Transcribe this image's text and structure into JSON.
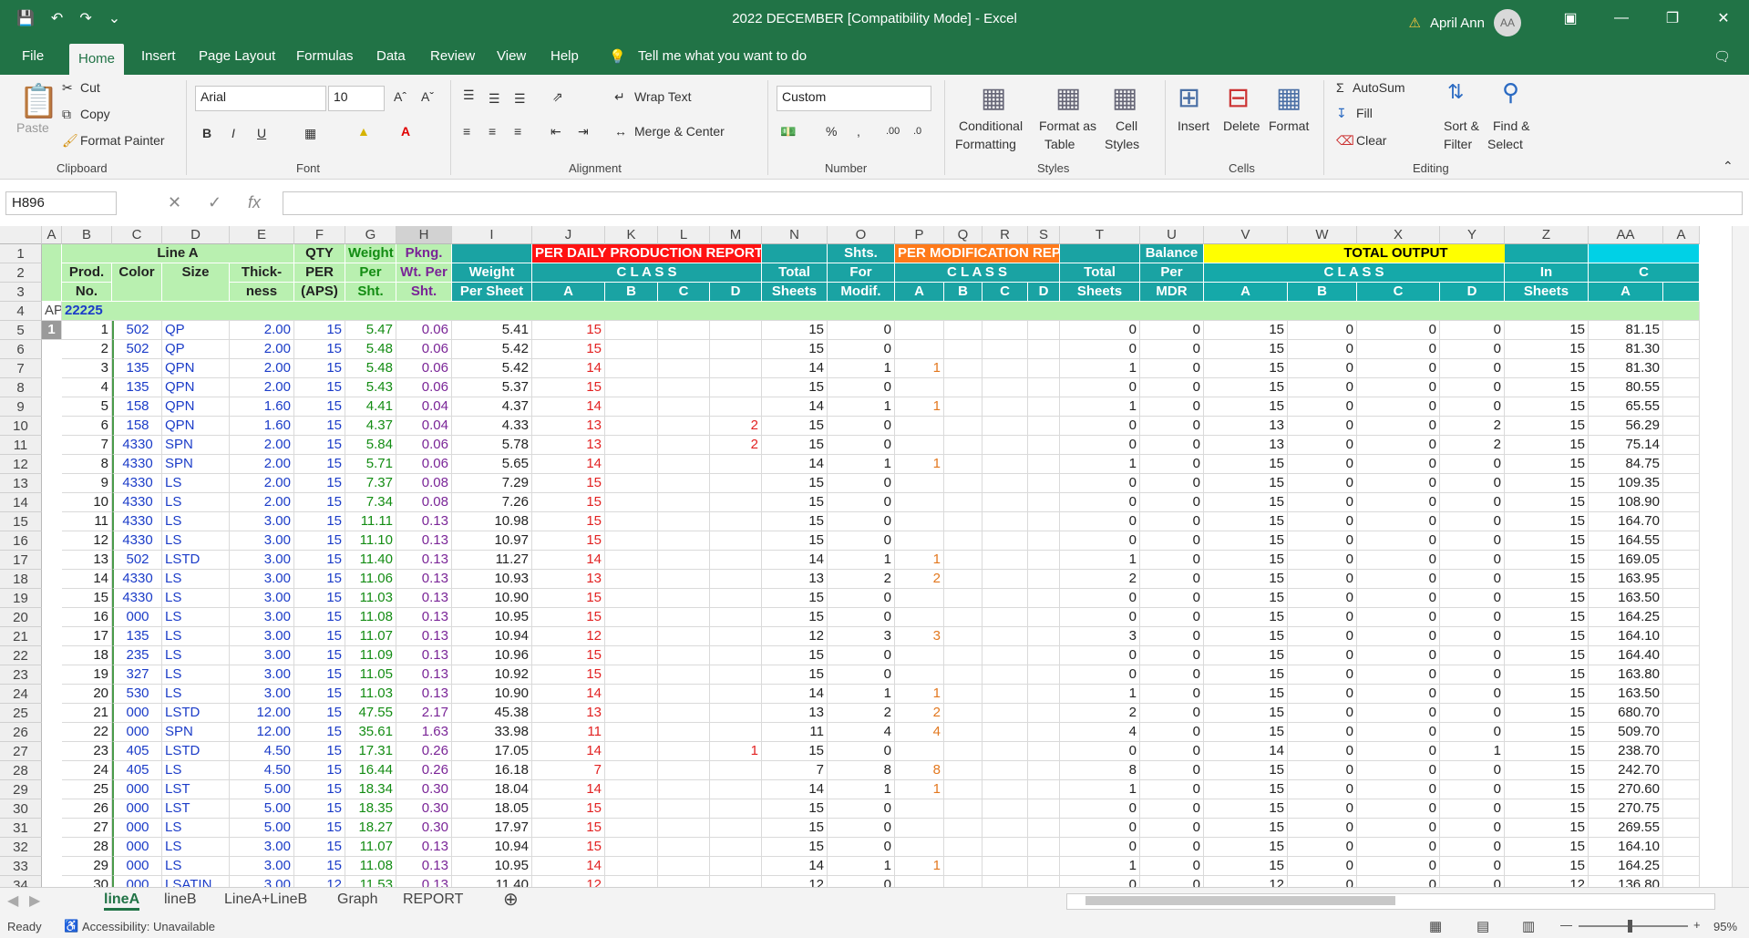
{
  "titlebar": {
    "title": "2022 DECEMBER  [Compatibility Mode]  -  Excel",
    "user_name": "April Ann",
    "avatar_initials": "AA"
  },
  "menu": {
    "tabs": [
      "File",
      "Home",
      "Insert",
      "Page Layout",
      "Formulas",
      "Data",
      "Review",
      "View",
      "Help"
    ],
    "active": "Home",
    "tell_me": "Tell me what you want to do"
  },
  "ribbon": {
    "clipboard": {
      "paste": "Paste",
      "cut": "Cut",
      "copy": "Copy",
      "format_painter": "Format Painter",
      "label": "Clipboard"
    },
    "font": {
      "name": "Arial",
      "size": "10",
      "label": "Font"
    },
    "alignment": {
      "wrap_text": "Wrap Text",
      "merge_center": "Merge & Center",
      "label": "Alignment"
    },
    "number": {
      "format": "Custom",
      "label": "Number"
    },
    "styles": {
      "conditional": "Conditional",
      "formatting": "Formatting",
      "format_as": "Format as",
      "table": "Table",
      "cell": "Cell",
      "cell_styles": "Styles",
      "label": "Styles"
    },
    "cells": {
      "insert": "Insert",
      "delete": "Delete",
      "format": "Format",
      "label": "Cells"
    },
    "editing": {
      "autosum": "AutoSum",
      "fill": "Fill",
      "clear": "Clear",
      "sort": "Sort &",
      "filter": "Filter",
      "find": "Find &",
      "select": "Select",
      "label": "Editing"
    }
  },
  "formula_bar": {
    "name_box": "H896",
    "formula": ""
  },
  "columns": [
    "A",
    "B",
    "C",
    "D",
    "E",
    "F",
    "G",
    "H",
    "I",
    "J",
    "K",
    "L",
    "M",
    "N",
    "O",
    "P",
    "Q",
    "R",
    "S",
    "T",
    "U",
    "V",
    "W",
    "X",
    "Y",
    "Z",
    "AA",
    "A"
  ],
  "row_numbers": [
    "1",
    "2",
    "3",
    "4",
    "5",
    "6",
    "7",
    "8",
    "9",
    "10",
    "11",
    "12",
    "13",
    "14",
    "15",
    "16",
    "17",
    "18",
    "19",
    "20",
    "21",
    "22",
    "23",
    "24",
    "25",
    "26",
    "27",
    "28",
    "29",
    "30",
    "31",
    "32",
    "33",
    "34"
  ],
  "headers": {
    "line_a": "Line A",
    "prod_no_1": "Prod.",
    "prod_no_2": "No.",
    "color": "Color",
    "size": "Size",
    "thick_1": "Thick-",
    "thick_2": "ness",
    "qty_1": "QTY",
    "qty_2": "PER",
    "qty_3": "(APS)",
    "weight_1": "Weight",
    "weight_2": "Per",
    "weight_3": "Sht.",
    "pkng_1": "Pkng.",
    "pkng_2": "Wt. Per",
    "pkng_3": "Sht.",
    "wps_1": "Weight",
    "wps_2": "Per Sheet",
    "dpr": "PER DAILY PRODUCTION REPORT (DPR)",
    "class": "C L A S S",
    "total_1": "Total",
    "total_2": "Sheets",
    "shts_1": "Shts.",
    "shts_2": "For",
    "shts_3": "Modif.",
    "mr": "PER MODIFICATION REPORT (MR)",
    "balance_1": "Balance",
    "balance_2": "Per",
    "balance_3": "MDR",
    "total_output": "TOTAL OUTPUT",
    "in_1": "In",
    "in_2": "Sheets",
    "class_c": "C",
    "a": "A",
    "b": "B",
    "c": "C",
    "d": "D"
  },
  "row4": {
    "a": "AP",
    "b": "22225"
  },
  "row5_a": "1",
  "rows": [
    [
      "1",
      "502",
      "QP",
      "2.00",
      "15",
      "5.47",
      "0.06",
      "5.41",
      "15",
      "",
      "",
      "",
      "15",
      "0",
      "",
      "",
      "",
      "",
      "0",
      "0",
      "15",
      "0",
      "0",
      "0",
      "15",
      "81.15"
    ],
    [
      "2",
      "502",
      "QP",
      "2.00",
      "15",
      "5.48",
      "0.06",
      "5.42",
      "15",
      "",
      "",
      "",
      "15",
      "0",
      "",
      "",
      "",
      "",
      "0",
      "0",
      "15",
      "0",
      "0",
      "0",
      "15",
      "81.30"
    ],
    [
      "3",
      "135",
      "QPN",
      "2.00",
      "15",
      "5.48",
      "0.06",
      "5.42",
      "14",
      "",
      "",
      "",
      "14",
      "1",
      "1",
      "",
      "",
      "",
      "1",
      "0",
      "15",
      "0",
      "0",
      "0",
      "15",
      "81.30"
    ],
    [
      "4",
      "135",
      "QPN",
      "2.00",
      "15",
      "5.43",
      "0.06",
      "5.37",
      "15",
      "",
      "",
      "",
      "15",
      "0",
      "",
      "",
      "",
      "",
      "0",
      "0",
      "15",
      "0",
      "0",
      "0",
      "15",
      "80.55"
    ],
    [
      "5",
      "158",
      "QPN",
      "1.60",
      "15",
      "4.41",
      "0.04",
      "4.37",
      "14",
      "",
      "",
      "",
      "14",
      "1",
      "1",
      "",
      "",
      "",
      "1",
      "0",
      "15",
      "0",
      "0",
      "0",
      "15",
      "65.55"
    ],
    [
      "6",
      "158",
      "QPN",
      "1.60",
      "15",
      "4.37",
      "0.04",
      "4.33",
      "13",
      "",
      "",
      "2",
      "15",
      "0",
      "",
      "",
      "",
      "",
      "0",
      "0",
      "13",
      "0",
      "0",
      "2",
      "15",
      "56.29"
    ],
    [
      "7",
      "4330",
      "SPN",
      "2.00",
      "15",
      "5.84",
      "0.06",
      "5.78",
      "13",
      "",
      "",
      "2",
      "15",
      "0",
      "",
      "",
      "",
      "",
      "0",
      "0",
      "13",
      "0",
      "0",
      "2",
      "15",
      "75.14"
    ],
    [
      "8",
      "4330",
      "SPN",
      "2.00",
      "15",
      "5.71",
      "0.06",
      "5.65",
      "14",
      "",
      "",
      "",
      "14",
      "1",
      "1",
      "",
      "",
      "",
      "1",
      "0",
      "15",
      "0",
      "0",
      "0",
      "15",
      "84.75"
    ],
    [
      "9",
      "4330",
      "LS",
      "2.00",
      "15",
      "7.37",
      "0.08",
      "7.29",
      "15",
      "",
      "",
      "",
      "15",
      "0",
      "",
      "",
      "",
      "",
      "0",
      "0",
      "15",
      "0",
      "0",
      "0",
      "15",
      "109.35"
    ],
    [
      "10",
      "4330",
      "LS",
      "2.00",
      "15",
      "7.34",
      "0.08",
      "7.26",
      "15",
      "",
      "",
      "",
      "15",
      "0",
      "",
      "",
      "",
      "",
      "0",
      "0",
      "15",
      "0",
      "0",
      "0",
      "15",
      "108.90"
    ],
    [
      "11",
      "4330",
      "LS",
      "3.00",
      "15",
      "11.11",
      "0.13",
      "10.98",
      "15",
      "",
      "",
      "",
      "15",
      "0",
      "",
      "",
      "",
      "",
      "0",
      "0",
      "15",
      "0",
      "0",
      "0",
      "15",
      "164.70"
    ],
    [
      "12",
      "4330",
      "LS",
      "3.00",
      "15",
      "11.10",
      "0.13",
      "10.97",
      "15",
      "",
      "",
      "",
      "15",
      "0",
      "",
      "",
      "",
      "",
      "0",
      "0",
      "15",
      "0",
      "0",
      "0",
      "15",
      "164.55"
    ],
    [
      "13",
      "502",
      "LSTD",
      "3.00",
      "15",
      "11.40",
      "0.13",
      "11.27",
      "14",
      "",
      "",
      "",
      "14",
      "1",
      "1",
      "",
      "",
      "",
      "1",
      "0",
      "15",
      "0",
      "0",
      "0",
      "15",
      "169.05"
    ],
    [
      "14",
      "4330",
      "LS",
      "3.00",
      "15",
      "11.06",
      "0.13",
      "10.93",
      "13",
      "",
      "",
      "",
      "13",
      "2",
      "2",
      "",
      "",
      "",
      "2",
      "0",
      "15",
      "0",
      "0",
      "0",
      "15",
      "163.95"
    ],
    [
      "15",
      "4330",
      "LS",
      "3.00",
      "15",
      "11.03",
      "0.13",
      "10.90",
      "15",
      "",
      "",
      "",
      "15",
      "0",
      "",
      "",
      "",
      "",
      "0",
      "0",
      "15",
      "0",
      "0",
      "0",
      "15",
      "163.50"
    ],
    [
      "16",
      "000",
      "LS",
      "3.00",
      "15",
      "11.08",
      "0.13",
      "10.95",
      "15",
      "",
      "",
      "",
      "15",
      "0",
      "",
      "",
      "",
      "",
      "0",
      "0",
      "15",
      "0",
      "0",
      "0",
      "15",
      "164.25"
    ],
    [
      "17",
      "135",
      "LS",
      "3.00",
      "15",
      "11.07",
      "0.13",
      "10.94",
      "12",
      "",
      "",
      "",
      "12",
      "3",
      "3",
      "",
      "",
      "",
      "3",
      "0",
      "15",
      "0",
      "0",
      "0",
      "15",
      "164.10"
    ],
    [
      "18",
      "235",
      "LS",
      "3.00",
      "15",
      "11.09",
      "0.13",
      "10.96",
      "15",
      "",
      "",
      "",
      "15",
      "0",
      "",
      "",
      "",
      "",
      "0",
      "0",
      "15",
      "0",
      "0",
      "0",
      "15",
      "164.40"
    ],
    [
      "19",
      "327",
      "LS",
      "3.00",
      "15",
      "11.05",
      "0.13",
      "10.92",
      "15",
      "",
      "",
      "",
      "15",
      "0",
      "",
      "",
      "",
      "",
      "0",
      "0",
      "15",
      "0",
      "0",
      "0",
      "15",
      "163.80"
    ],
    [
      "20",
      "530",
      "LS",
      "3.00",
      "15",
      "11.03",
      "0.13",
      "10.90",
      "14",
      "",
      "",
      "",
      "14",
      "1",
      "1",
      "",
      "",
      "",
      "1",
      "0",
      "15",
      "0",
      "0",
      "0",
      "15",
      "163.50"
    ],
    [
      "21",
      "000",
      "LSTD",
      "12.00",
      "15",
      "47.55",
      "2.17",
      "45.38",
      "13",
      "",
      "",
      "",
      "13",
      "2",
      "2",
      "",
      "",
      "",
      "2",
      "0",
      "15",
      "0",
      "0",
      "0",
      "15",
      "680.70"
    ],
    [
      "22",
      "000",
      "SPN",
      "12.00",
      "15",
      "35.61",
      "1.63",
      "33.98",
      "11",
      "",
      "",
      "",
      "11",
      "4",
      "4",
      "",
      "",
      "",
      "4",
      "0",
      "15",
      "0",
      "0",
      "0",
      "15",
      "509.70"
    ],
    [
      "23",
      "405",
      "LSTD",
      "4.50",
      "15",
      "17.31",
      "0.26",
      "17.05",
      "14",
      "",
      "",
      "1",
      "15",
      "0",
      "",
      "",
      "",
      "",
      "0",
      "0",
      "14",
      "0",
      "0",
      "1",
      "15",
      "238.70"
    ],
    [
      "24",
      "405",
      "LS",
      "4.50",
      "15",
      "16.44",
      "0.26",
      "16.18",
      "7",
      "",
      "",
      "",
      "7",
      "8",
      "8",
      "",
      "",
      "",
      "8",
      "0",
      "15",
      "0",
      "0",
      "0",
      "15",
      "242.70"
    ],
    [
      "25",
      "000",
      "LST",
      "5.00",
      "15",
      "18.34",
      "0.30",
      "18.04",
      "14",
      "",
      "",
      "",
      "14",
      "1",
      "1",
      "",
      "",
      "",
      "1",
      "0",
      "15",
      "0",
      "0",
      "0",
      "15",
      "270.60"
    ],
    [
      "26",
      "000",
      "LST",
      "5.00",
      "15",
      "18.35",
      "0.30",
      "18.05",
      "15",
      "",
      "",
      "",
      "15",
      "0",
      "",
      "",
      "",
      "",
      "0",
      "0",
      "15",
      "0",
      "0",
      "0",
      "15",
      "270.75"
    ],
    [
      "27",
      "000",
      "LS",
      "5.00",
      "15",
      "18.27",
      "0.30",
      "17.97",
      "15",
      "",
      "",
      "",
      "15",
      "0",
      "",
      "",
      "",
      "",
      "0",
      "0",
      "15",
      "0",
      "0",
      "0",
      "15",
      "269.55"
    ],
    [
      "28",
      "000",
      "LS",
      "3.00",
      "15",
      "11.07",
      "0.13",
      "10.94",
      "15",
      "",
      "",
      "",
      "15",
      "0",
      "",
      "",
      "",
      "",
      "0",
      "0",
      "15",
      "0",
      "0",
      "0",
      "15",
      "164.10"
    ],
    [
      "29",
      "000",
      "LS",
      "3.00",
      "15",
      "11.08",
      "0.13",
      "10.95",
      "14",
      "",
      "",
      "",
      "14",
      "1",
      "1",
      "",
      "",
      "",
      "1",
      "0",
      "15",
      "0",
      "0",
      "0",
      "15",
      "164.25"
    ],
    [
      "30",
      "000",
      "LSATIN",
      "3.00",
      "12",
      "11.53",
      "0.13",
      "11.40",
      "12",
      "",
      "",
      "",
      "12",
      "0",
      "",
      "",
      "",
      "",
      "0",
      "0",
      "12",
      "0",
      "0",
      "0",
      "12",
      "136.80"
    ]
  ],
  "sheet_tabs": [
    "lineA",
    "lineB",
    "LineA+LineB",
    "Graph",
    "REPORT"
  ],
  "active_sheet": "lineA",
  "status": {
    "ready": "Ready",
    "accessibility": "Accessibility: Unavailable",
    "zoom": "95%"
  },
  "colors": {
    "excel_green": "#217346"
  }
}
